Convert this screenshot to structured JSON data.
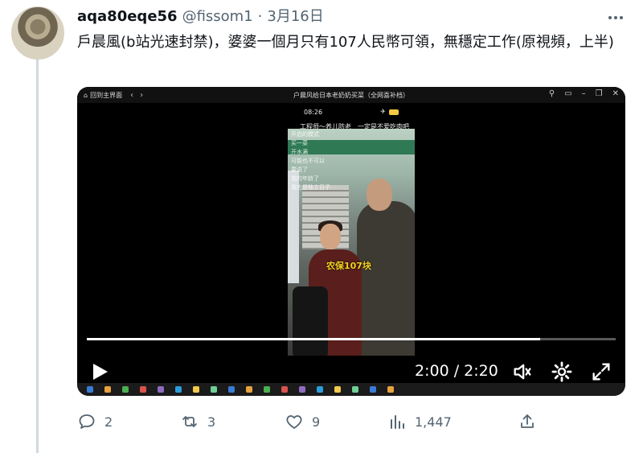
{
  "user": {
    "display_name": "aqa80eqe56",
    "handle": "@fissom1",
    "separator": "·",
    "date": "3月16日"
  },
  "tweet": {
    "text": "戶晨風(b站光速封禁)，婆婆一個月只有107人民幣可領，無穩定工作(原視頻，上半)"
  },
  "media": {
    "window": {
      "home_label": "回到主界面",
      "title": "户晨风给日本老奶奶买菜（全网喜补档）"
    },
    "phone": {
      "time": "08:26",
      "caption": "工程师～养儿防老　一定是不爱吃肉吧"
    },
    "clip_overlay_lines": [
      "开启的模式",
      "买一菜",
      "开水满",
      "可能也不可以",
      "要说了",
      "我的年龄了",
      "我也是独立日子"
    ],
    "subtitle": "农保107块",
    "player": {
      "time_readout": "2:00 / 2:20",
      "progress": 0.857
    }
  },
  "actions": {
    "replies": "2",
    "retweets": "3",
    "likes": "9",
    "views": "1,447"
  },
  "colors": {
    "secondary_text": "#536471",
    "thread_line": "#cfd9de",
    "subtitle": "#f4d21c"
  },
  "icons": [
    "more-icon",
    "home-icon",
    "back-icon",
    "forward-icon",
    "pin-icon",
    "pip-icon",
    "minimize-icon",
    "restore-icon",
    "close-icon",
    "play-icon",
    "volume-icon",
    "settings-icon",
    "fullscreen-icon",
    "reply-icon",
    "retweet-icon",
    "like-icon",
    "views-icon",
    "share-icon"
  ]
}
